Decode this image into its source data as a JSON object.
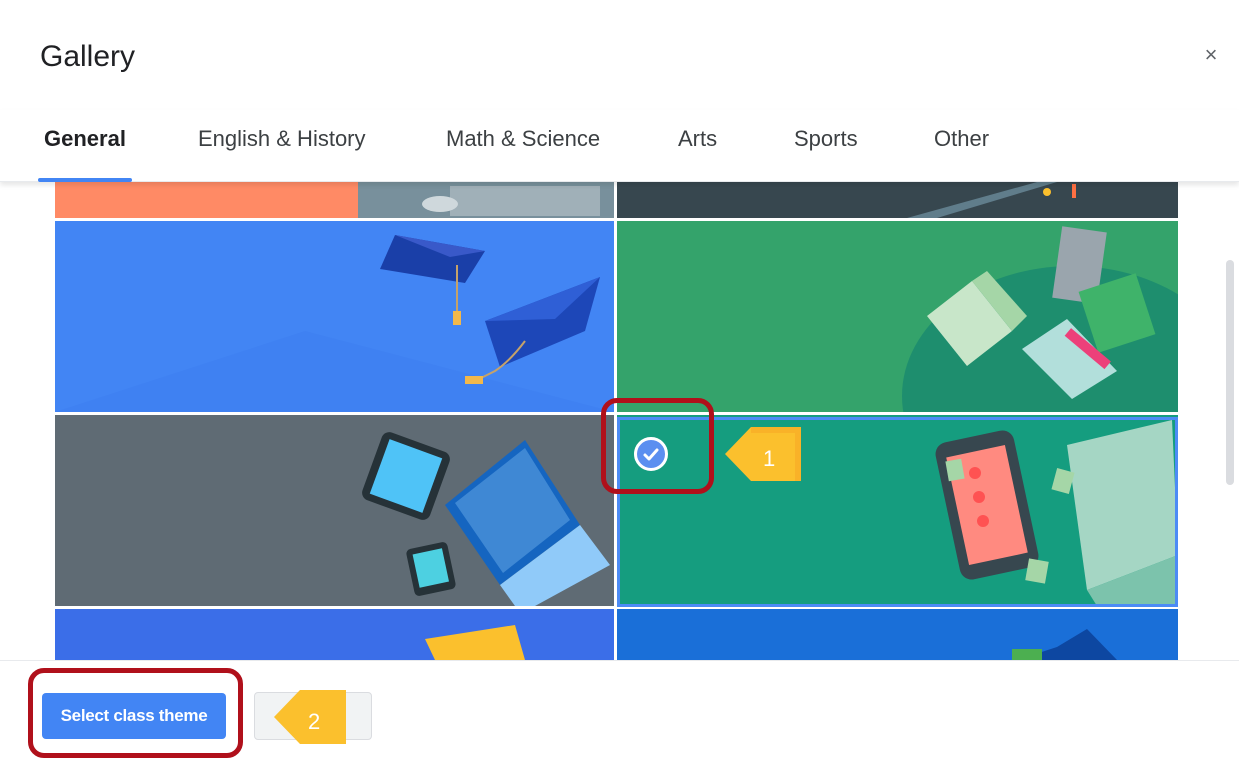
{
  "dialog": {
    "title": "Gallery",
    "close_glyph": "×"
  },
  "tabs": [
    {
      "label": "General",
      "active": true
    },
    {
      "label": "English & History",
      "active": false
    },
    {
      "label": "Math & Science",
      "active": false
    },
    {
      "label": "Arts",
      "active": false
    },
    {
      "label": "Sports",
      "active": false
    },
    {
      "label": "Other",
      "active": false
    }
  ],
  "gallery": {
    "selected_theme": "phone-and-papers",
    "tiles": [
      {
        "name": "top-left-partial",
        "colors": [
          "#ff8a65",
          "#78909c"
        ]
      },
      {
        "name": "top-right-partial",
        "colors": [
          "#37474f"
        ]
      },
      {
        "name": "graduation-caps",
        "colors": [
          "#4285f4"
        ]
      },
      {
        "name": "open-books",
        "colors": [
          "#34a36b",
          "#1e8e6e"
        ]
      },
      {
        "name": "laptop-and-tablets",
        "colors": [
          "#5f6b74"
        ]
      },
      {
        "name": "phone-and-papers",
        "colors": [
          "#159d7f"
        ]
      },
      {
        "name": "bottom-left-partial",
        "colors": [
          "#3b6ee8"
        ]
      },
      {
        "name": "bottom-right-partial",
        "colors": [
          "#1a6fd8"
        ]
      }
    ],
    "check_icon": "check-circle-icon"
  },
  "footer": {
    "select_button_label": "Select class theme",
    "secondary_button_label": ""
  },
  "annotations": {
    "marker_1": "1",
    "marker_2": "2",
    "highlight_color": "#b0101b",
    "marker_color": "#fbc02d"
  }
}
